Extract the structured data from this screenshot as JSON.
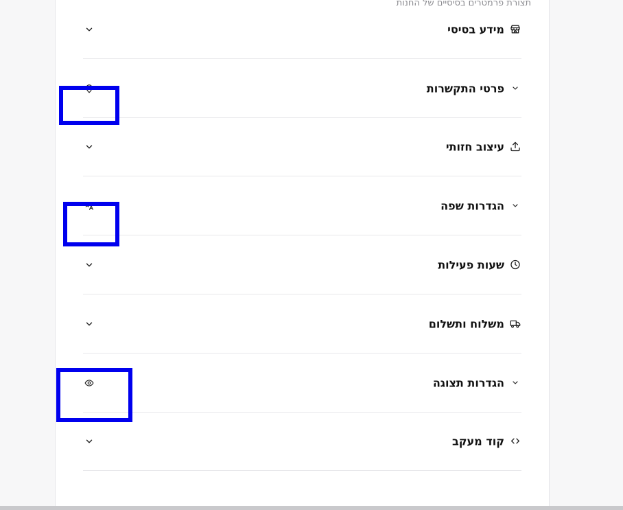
{
  "subtitle": "תצורת פרמטרים בסיסיים של החנות",
  "sections": [
    {
      "label": "מידע בסיסי",
      "icon": "store-icon"
    },
    {
      "label": "פרטי התקשרות",
      "icon": "map-pin-icon"
    },
    {
      "label": "עיצוב חזותי",
      "icon": "upload-icon"
    },
    {
      "label": "הגדרות שפה",
      "icon": "translate-icon"
    },
    {
      "label": "שעות פעילות",
      "icon": "clock-icon"
    },
    {
      "label": "משלוח ותשלום",
      "icon": "truck-icon"
    },
    {
      "label": "הגדרות תצוגה",
      "icon": "eye-icon"
    },
    {
      "label": "קוד מעקב",
      "icon": "code-icon"
    }
  ],
  "highlight_color": "#0000ee"
}
